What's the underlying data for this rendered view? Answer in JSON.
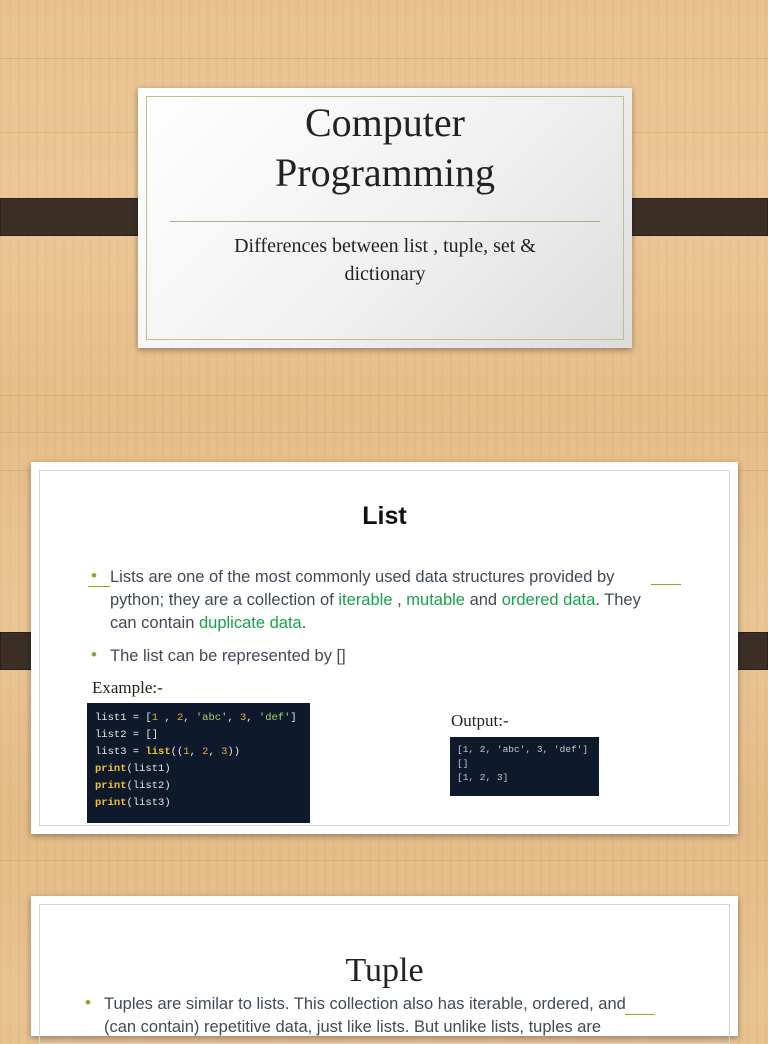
{
  "slide1": {
    "title_line1": "Computer",
    "title_line2": "Programming",
    "subtitle_line1": "Differences between list , tuple, set &",
    "subtitle_line2": "dictionary"
  },
  "slide2": {
    "title": "List",
    "bullet1": {
      "line1": "Lists are one of the most commonly used data structures provided by",
      "line2_pre": "python; they are a collection of ",
      "line2_green1": "iterable",
      "line2_sep": " , ",
      "line2_green2": "mutable",
      "line2_and": " and ",
      "line2_green3": "ordered data",
      "line2_post": ". They",
      "line3_pre": "can contain ",
      "line3_green": "duplicate data",
      "line3_post": "."
    },
    "bullet2": "The list can be represented by []",
    "example_label": "Example:-",
    "output_label": "Output:-",
    "code": {
      "l1_a": "list1 = [",
      "l1_n1": "1",
      "l1_b": " , ",
      "l1_n2": "2",
      "l1_c": ", ",
      "l1_s1": "'abc'",
      "l1_d": ", ",
      "l1_n3": "3",
      "l1_e": ", ",
      "l1_s2": "'def'",
      "l1_f": "]",
      "l2": "list2 = []",
      "l3_a": "list3 = ",
      "l3_fn": "list",
      "l3_b": "((",
      "l3_n1": "1",
      "l3_c": ", ",
      "l3_n2": "2",
      "l3_d": ", ",
      "l3_n3": "3",
      "l3_e": "))",
      "p1_fn": "print",
      "p1_arg": "(list1)",
      "p2_fn": "print",
      "p2_arg": "(list2)",
      "p3_fn": "print",
      "p3_arg": "(list3)"
    },
    "output": {
      "line1": "[1, 2, 'abc', 3, 'def']",
      "line2": "[]",
      "line3": "[1, 2, 3]"
    }
  },
  "slide3": {
    "title": "Tuple",
    "bullet1_line1": "Tuples are similar to lists. This collection also has iterable, ordered, and",
    "bullet1_line2": "(can contain) repetitive data, just like lists. But unlike lists, tuples are"
  },
  "colors": {
    "accent_green": "#7cae2a",
    "keyword_green": "#17a34a",
    "strap": "#3c2f26",
    "code_bg": "#0e1a2b"
  }
}
